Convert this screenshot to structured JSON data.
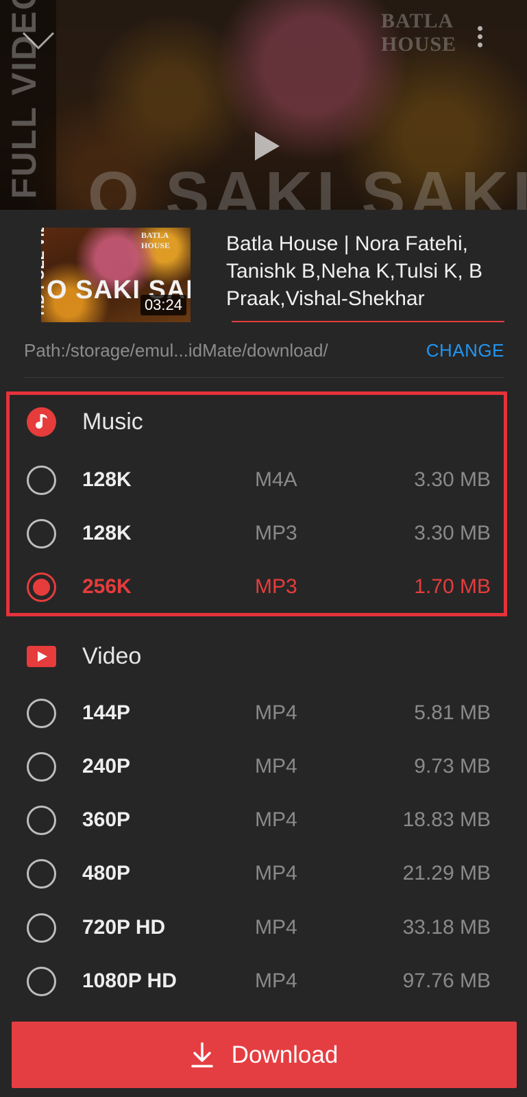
{
  "preview": {
    "side_text": "FULL VIDEO",
    "big_text": "O SAKI SAKI",
    "brand_text": "BATLA HOUSE"
  },
  "media": {
    "thumb_side_text": "HD FULL VIDEO",
    "thumb_big_text": "O SAKI SAKI",
    "thumb_brand_text": "BATLA HOUSE",
    "duration": "03:24",
    "title": "Batla House | Nora Fatehi, Tanishk B,Neha K,Tulsi K, B Praak,Vishal-Shekhar",
    "path": "Path:/storage/emul...idMate/download/",
    "change_label": "CHANGE"
  },
  "colors": {
    "accent": "#e63c3c",
    "highlight_border": "#e5323a",
    "link": "#2196f3",
    "background": "#262626"
  },
  "music": {
    "label": "Music",
    "icon": "music-note-icon",
    "options": [
      {
        "quality": "128K",
        "format": "M4A",
        "size": "3.30 MB",
        "selected": false
      },
      {
        "quality": "128K",
        "format": "MP3",
        "size": "3.30 MB",
        "selected": false
      },
      {
        "quality": "256K",
        "format": "MP3",
        "size": "1.70 MB",
        "selected": true
      }
    ]
  },
  "video": {
    "label": "Video",
    "icon": "youtube-play-icon",
    "options": [
      {
        "quality": "144P",
        "format": "MP4",
        "size": "5.81 MB",
        "selected": false
      },
      {
        "quality": "240P",
        "format": "MP4",
        "size": "9.73 MB",
        "selected": false
      },
      {
        "quality": "360P",
        "format": "MP4",
        "size": "18.83 MB",
        "selected": false
      },
      {
        "quality": "480P",
        "format": "MP4",
        "size": "21.29 MB",
        "selected": false
      },
      {
        "quality": "720P HD",
        "format": "MP4",
        "size": "33.18 MB",
        "selected": false
      },
      {
        "quality": "1080P HD",
        "format": "MP4",
        "size": "97.76 MB",
        "selected": false
      }
    ]
  },
  "download": {
    "label": "Download",
    "icon": "download-arrow-icon"
  }
}
